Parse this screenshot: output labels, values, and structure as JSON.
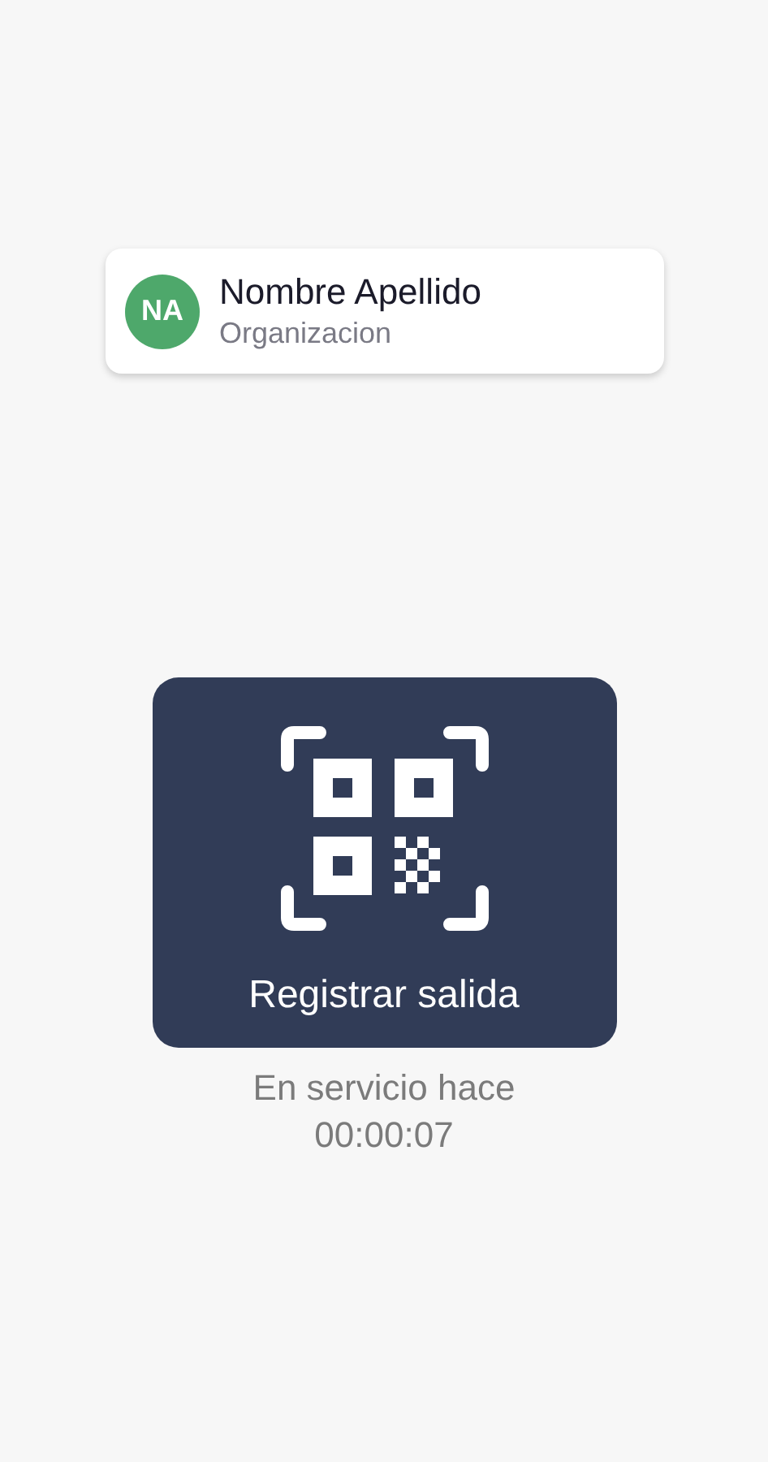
{
  "user": {
    "initials": "NA",
    "name": "Nombre Apellido",
    "organization": "Organizacion"
  },
  "action_button": {
    "label": "Registrar salida"
  },
  "status": {
    "label": "En servicio hace",
    "elapsed": "00:00:07"
  }
}
